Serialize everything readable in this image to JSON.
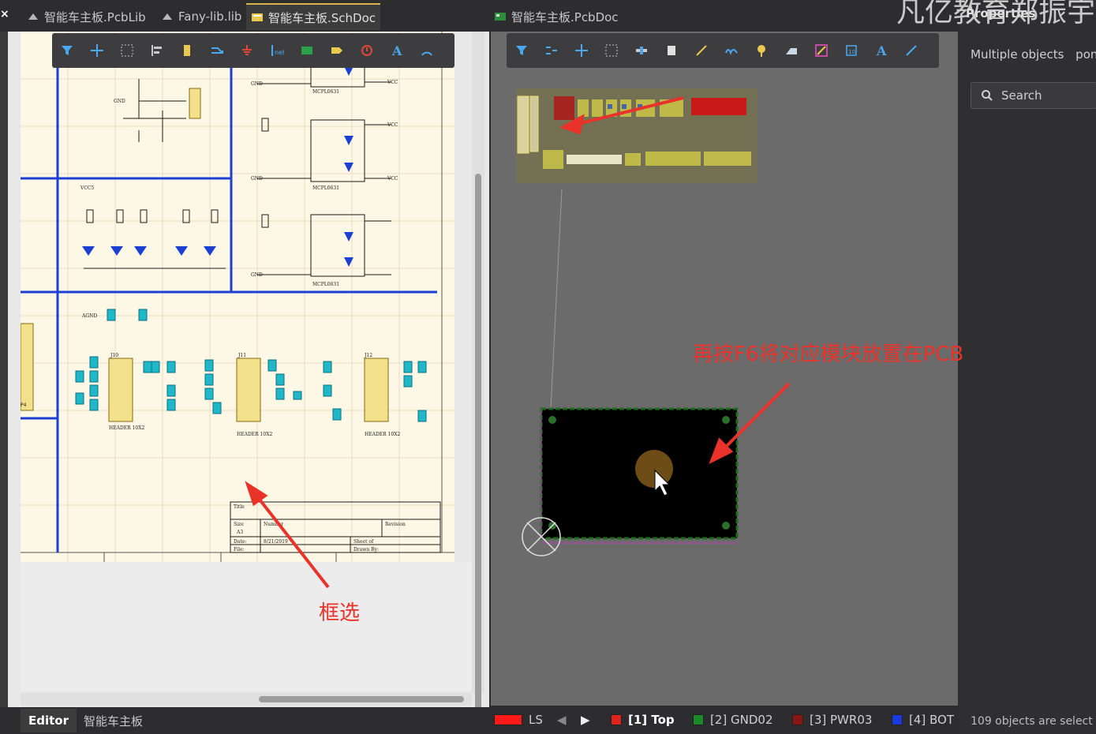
{
  "tabs": [
    {
      "label": "智能车主板.PcbLib",
      "icon": "pcblib-icon"
    },
    {
      "label": "Fany-lib.lib",
      "icon": "lib-icon"
    },
    {
      "label": "智能车主板.SchDoc",
      "icon": "schdoc-icon",
      "active": true
    },
    {
      "label": "智能车主板.PcbDoc",
      "icon": "pcbdoc-icon"
    }
  ],
  "close_label": "×",
  "watermark": "凡亿教育郑振宇",
  "properties": {
    "title": "Properties",
    "selection": "Multiple objects",
    "selection_extra": "pon",
    "search_placeholder": "Search",
    "footer": "109 objects are select"
  },
  "editor_tabs": [
    {
      "label": "Editor",
      "active": true
    },
    {
      "label": "智能车主板",
      "active": false
    }
  ],
  "pcb_layers": {
    "ls_label": "LS",
    "layers": [
      {
        "label": "[1] Top",
        "color": "#e0231b",
        "active": true
      },
      {
        "label": "[2] GND02",
        "color": "#1a8a2a",
        "active": false
      },
      {
        "label": "[3] PWR03",
        "color": "#8a1515",
        "active": false
      },
      {
        "label": "[4] BOT",
        "color": "#1a3ae0",
        "active": false
      }
    ]
  },
  "annotations": {
    "pcb_note": "再按F6将对应模块放置在PCB",
    "sch_note": "框选"
  },
  "schematic_labels": {
    "gnd": "GND",
    "vcc": "VCC",
    "vcc5": "VCC5",
    "agnd": "AGND",
    "mcpl": "MCPL0631",
    "header": "HEADER 10X2",
    "revision": "Revision",
    "title": "Title",
    "size": "Size",
    "number": "Number",
    "date": "Date:",
    "file": "File:",
    "sheet_of": "Sheet of",
    "drawn_by": "Drawn By:",
    "size_val": "A3",
    "date_val": "8/21/2019",
    "p4_label": "P4",
    "j10": "J10",
    "j11": "J11",
    "j12": "J12"
  }
}
